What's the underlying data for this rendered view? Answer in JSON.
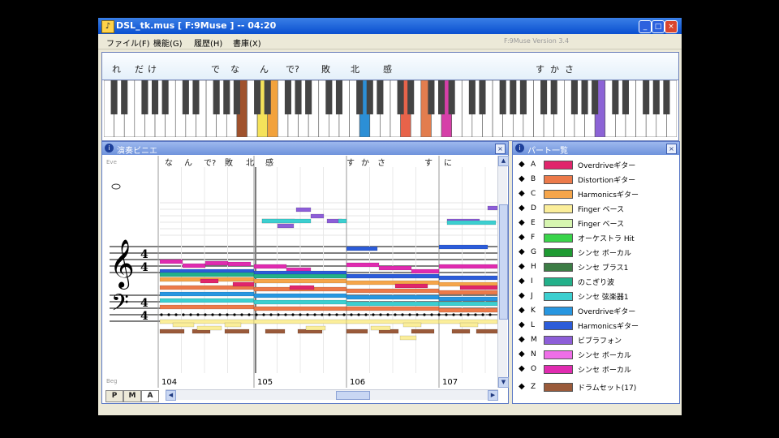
{
  "window": {
    "title": "DSL_tk.mus [ F:9Muse ] -- 04:20",
    "buttons": {
      "minimize": "_",
      "maximize": "□",
      "close": "×"
    }
  },
  "menu": {
    "items": [
      "ファイル(F)",
      "機能(G)",
      "履歴(H)",
      "書庫(X)"
    ],
    "right_text": "F:9Muse Version 3.4"
  },
  "lyrics_top": [
    "れ",
    "だ",
    "け",
    "で",
    "な",
    "ん",
    "で?",
    "敗",
    "北",
    "感",
    "す",
    "か",
    "さ"
  ],
  "keyboard_highlights": [
    {
      "key": 13,
      "color": "#a0522d"
    },
    {
      "key": 15,
      "color": "#f5e25a"
    },
    {
      "key": 16,
      "color": "#f2a23c"
    },
    {
      "key": 25,
      "color": "#2c8fd6"
    },
    {
      "key": 29,
      "color": "#e8634a"
    },
    {
      "key": 31,
      "color": "#e27d4e"
    },
    {
      "key": 33,
      "color": "#d63fa8"
    },
    {
      "key": 48,
      "color": "#8c63d6"
    }
  ],
  "score": {
    "title": "演奏ビニエ",
    "lyrics": [
      "な",
      "ん",
      "で?",
      "敗",
      "北",
      "感",
      "す",
      "か",
      "さ",
      "す",
      "に"
    ],
    "measures": [
      "104",
      "105",
      "106",
      "107"
    ],
    "top_label": "Eve",
    "bottom_label": "Beg",
    "modes": [
      "P",
      "M",
      "A"
    ],
    "treble_clef": "𝄞",
    "bass_clef": "𝄢",
    "time_signature": [
      "4",
      "4"
    ]
  },
  "parts": {
    "title": "パート一覧",
    "items": [
      {
        "letter": "A",
        "name": "Overdriveギター",
        "color": "#e0256b"
      },
      {
        "letter": "B",
        "name": "Distortionギター",
        "color": "#ec7a4a"
      },
      {
        "letter": "C",
        "name": "Harmonicsギター",
        "color": "#f5a54a"
      },
      {
        "letter": "D",
        "name": "Finger ベース",
        "color": "#fbee9a"
      },
      {
        "letter": "E",
        "name": "Finger ベース",
        "color": "#d7f5b0"
      },
      {
        "letter": "F",
        "name": "オーケストラ Hit",
        "color": "#39d44a"
      },
      {
        "letter": "G",
        "name": "シンセ ボーカル",
        "color": "#1e9a32"
      },
      {
        "letter": "H",
        "name": "シンセ ブラス1",
        "color": "#3c7c45"
      },
      {
        "letter": "I",
        "name": "のこぎり波",
        "color": "#23b08a"
      },
      {
        "letter": "J",
        "name": "シンセ 弦楽器1",
        "color": "#3ccfd0"
      },
      {
        "letter": "K",
        "name": "Overdriveギター",
        "color": "#2796e0"
      },
      {
        "letter": "L",
        "name": "Harmonicsギター",
        "color": "#2c5cd9"
      },
      {
        "letter": "M",
        "name": "ビブラフォン",
        "color": "#8d5ed8"
      },
      {
        "letter": "N",
        "name": "シンセ ボーカル",
        "color": "#ef6ee8"
      },
      {
        "letter": "O",
        "name": "シンセ ボーカル",
        "color": "#e02bb0"
      },
      {
        "letter": "Z",
        "name": "ドラムセット(17)",
        "color": "#9a5a3a"
      }
    ]
  }
}
